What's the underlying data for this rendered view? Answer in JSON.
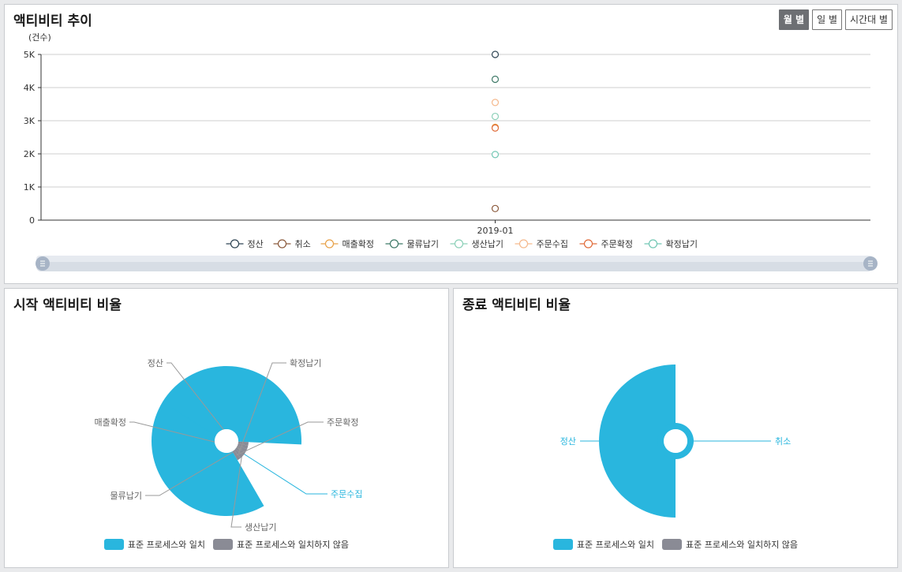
{
  "colors": {
    "match": "#29b6de",
    "mismatch": "#8a8b95",
    "series": [
      "#2f4554",
      "#8b5a3c",
      "#e8a147",
      "#3f7a68",
      "#8cd0b8",
      "#f5b98d",
      "#e06c3a",
      "#72c7b4"
    ]
  },
  "trend": {
    "title": "액티비티 추이",
    "buttons": [
      {
        "label": "월 별",
        "active": true
      },
      {
        "label": "일 별",
        "active": false
      },
      {
        "label": "시간대 별",
        "active": false
      }
    ],
    "slider_handle_icon": "menu-lines-icon"
  },
  "start_panel": {
    "title": "시작 액티비티 비율",
    "legend": [
      "표준 프로세스와 일치",
      "표준 프로세스와 일치하지 않음"
    ]
  },
  "end_panel": {
    "title": "종료 액티비티 비율",
    "legend": [
      "표준 프로세스와 일치",
      "표준 프로세스와 일치하지 않음"
    ]
  },
  "chart_data": [
    {
      "type": "scatter",
      "title": "",
      "ylabel": "(건수)",
      "xlabel": "",
      "categories": [
        "2019-01"
      ],
      "ylim": [
        0,
        5000
      ],
      "yticks": [
        "0",
        "1K",
        "2K",
        "3K",
        "4K",
        "5K"
      ],
      "grid": true,
      "legend_position": "bottom",
      "series": [
        {
          "name": "정산",
          "values": [
            5000
          ]
        },
        {
          "name": "취소",
          "values": [
            350
          ]
        },
        {
          "name": "매출확정",
          "values": [
            2800
          ]
        },
        {
          "name": "물류납기",
          "values": [
            4250
          ]
        },
        {
          "name": "생산납기",
          "values": [
            3130
          ]
        },
        {
          "name": "주문수집",
          "values": [
            3550
          ]
        },
        {
          "name": "주문확정",
          "values": [
            2780
          ]
        },
        {
          "name": "확정납기",
          "values": [
            1980
          ]
        }
      ]
    },
    {
      "type": "pie",
      "title": "시작 액티비티 비율",
      "slices": [
        {
          "label": "주문수집",
          "value": 95,
          "standard": true
        },
        {
          "label": "생산납기",
          "value": 3,
          "standard": false
        },
        {
          "label": "물류납기",
          "value": 3,
          "standard": false
        },
        {
          "label": "매출확정",
          "value": 3,
          "standard": false
        },
        {
          "label": "정산",
          "value": 3,
          "standard": false
        },
        {
          "label": "확정납기",
          "value": 3,
          "standard": false
        },
        {
          "label": "주문확정",
          "value": 3,
          "standard": false
        }
      ]
    },
    {
      "type": "pie",
      "title": "종료 액티비티 비율",
      "slices": [
        {
          "label": "정산",
          "value": 50,
          "standard": true
        },
        {
          "label": "취소",
          "value": 50,
          "standard": true
        }
      ]
    }
  ]
}
